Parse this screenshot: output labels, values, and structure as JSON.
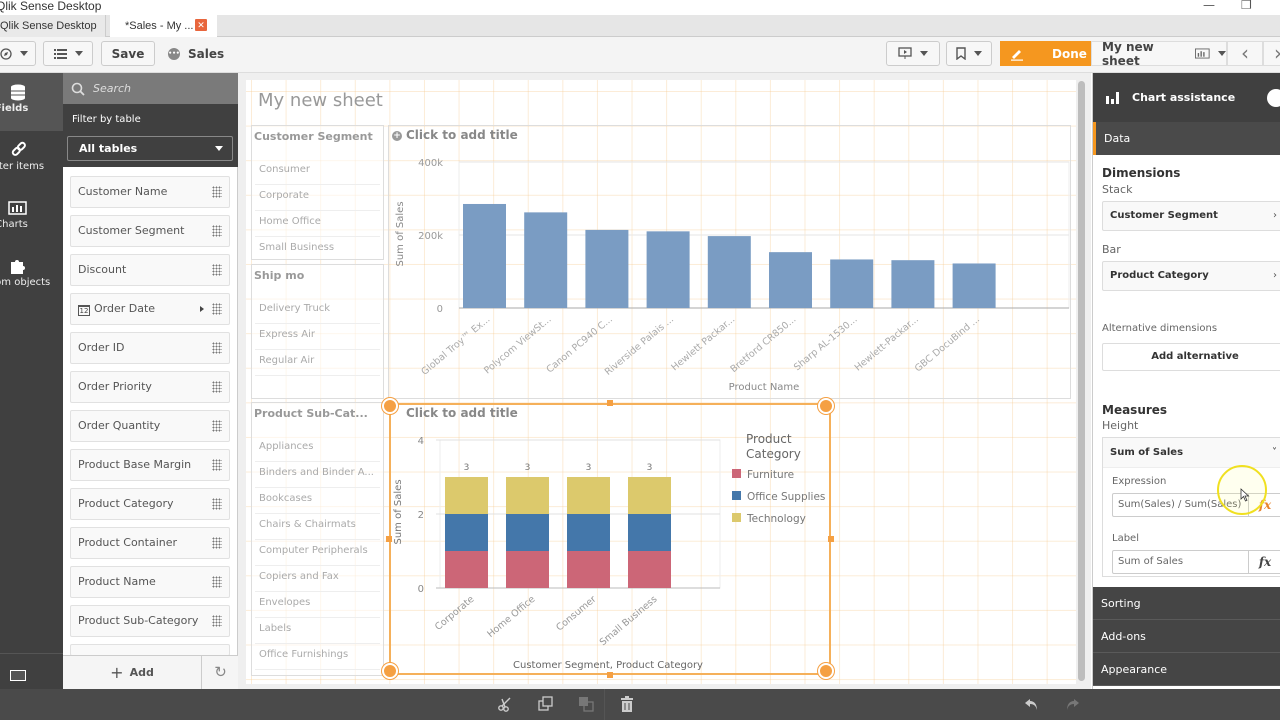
{
  "window": {
    "title": "Qlik Sense Desktop",
    "minimize_glyph": "—",
    "restore_glyph": "❐"
  },
  "tabs": [
    {
      "label": "Qlik Sense Desktop hub",
      "active": false
    },
    {
      "label": "*Sales - My ...",
      "active": true,
      "close_glyph": "✕"
    }
  ],
  "toolbar": {
    "nav_icon": "compass-icon",
    "list_icon": "list-icon",
    "save_label": "Save",
    "app_name": "Sales",
    "present_icon": "presentation-icon",
    "bookmark_icon": "bookmark-icon",
    "done_label": "Done",
    "sheet_name": "My new sheet",
    "prev_glyph": "‹",
    "next_glyph": "›"
  },
  "left_nav": {
    "items": [
      {
        "label": "Fields",
        "icon": "database-icon",
        "active": true
      },
      {
        "label": "Master items",
        "icon": "link-icon",
        "active": false
      },
      {
        "label": "Charts",
        "icon": "bar-chart-icon",
        "active": false
      },
      {
        "label": "Custom objects",
        "icon": "puzzle-icon",
        "active": false
      }
    ],
    "bottom_icon": "variables-icon"
  },
  "fields_panel": {
    "search_placeholder": "Search",
    "filter_label": "Filter by table",
    "table_selected": "All tables",
    "fields": [
      {
        "name": "Customer Name"
      },
      {
        "name": "Customer Segment"
      },
      {
        "name": "Discount"
      },
      {
        "name": "Order Date",
        "calendar": true,
        "calendar_glyph": "12",
        "expandable": true
      },
      {
        "name": "Order ID"
      },
      {
        "name": "Order Priority"
      },
      {
        "name": "Order Quantity"
      },
      {
        "name": "Product Base Margin"
      },
      {
        "name": "Product Category"
      },
      {
        "name": "Product Container"
      },
      {
        "name": "Product Name"
      },
      {
        "name": "Product Sub-Category"
      }
    ],
    "add_label": "Add",
    "add_glyph": "+",
    "refresh_glyph": "↻"
  },
  "sheet": {
    "title": "My new sheet",
    "filter_panes": [
      {
        "title": "Customer Segment",
        "values": [
          "Consumer",
          "Corporate",
          "Home Office",
          "Small Business"
        ]
      },
      {
        "title": "Ship mo",
        "values": [
          "Delivery Truck",
          "Express Air",
          "Regular Air"
        ]
      },
      {
        "title": "Product Sub-Cat...",
        "values": [
          "Appliances",
          "Binders and Binder A...",
          "Bookcases",
          "Chairs & Chairmats",
          "Computer Peripherals",
          "Copiers and Fax",
          "Envelopes",
          "Labels",
          "Office Furnishings"
        ]
      }
    ],
    "add_title_placeholder": "Click to add title",
    "add_title_glyph": "+"
  },
  "chart_data": [
    {
      "type": "bar",
      "title": "Click to add title",
      "xlabel": "Product Name",
      "ylabel": "Sum of Sales",
      "ylim": [
        0,
        400000
      ],
      "yticks": [
        0,
        200000,
        400000
      ],
      "ytick_labels": [
        "0",
        "200k",
        "400k"
      ],
      "categories": [
        "Global Troy™ Ex...",
        "Polycom ViewSt...",
        "Canon PC940 C...",
        "Riverside Palais ...",
        "Hewlett Packar...",
        "Bretford CR850...",
        "Sharp AL-1530...",
        "Hewlett-Packar...",
        "GBC DocuBind ..."
      ],
      "values": [
        285000,
        262000,
        214000,
        210000,
        197000,
        153000,
        133000,
        131000,
        122000
      ],
      "color": "#7a9cc3",
      "grid": true
    },
    {
      "type": "bar",
      "stacked": true,
      "title": "Click to add title",
      "xlabel": "Customer Segment, Product Category",
      "ylabel": "Sum of Sales",
      "ylim": [
        0,
        4
      ],
      "yticks": [
        0,
        2,
        4
      ],
      "ytick_labels": [
        "0",
        "2",
        "4"
      ],
      "categories": [
        "Corporate",
        "Home Office",
        "Consumer",
        "Small Business"
      ],
      "series": [
        {
          "name": "Furniture",
          "color": "#cc6677",
          "values": [
            1,
            1,
            1,
            1
          ]
        },
        {
          "name": "Office Supplies",
          "color": "#4477aa",
          "values": [
            1,
            1,
            1,
            1
          ]
        },
        {
          "name": "Technology",
          "color": "#dcc96c",
          "values": [
            1,
            1,
            1,
            1
          ]
        }
      ],
      "totals": [
        "3",
        "3",
        "3",
        "3"
      ],
      "legend_title": "Product Category",
      "legend_position": "right"
    }
  ],
  "right_panel": {
    "header": "Chart assistance",
    "data_tab": "Data",
    "dimensions_title": "Dimensions",
    "stack_label": "Stack",
    "stack_dimension": "Customer Segment",
    "bar_label": "Bar",
    "bar_dimension": "Product Category",
    "alt_dimensions_label": "Alternative dimensions",
    "add_alternative": "Add alternative",
    "measures_title": "Measures",
    "height_label": "Height",
    "measure_name": "Sum of Sales",
    "expression_label": "Expression",
    "expression_value": "Sum(Sales) / Sum(Sales)",
    "label_label": "Label",
    "label_value": "Sum of Sales",
    "fx_glyph": "fx",
    "chevron_right": "›",
    "chevron_down": "˅",
    "sections": [
      "Sorting",
      "Add-ons",
      "Appearance"
    ]
  },
  "bottom_bar": {
    "icons": [
      "cut-icon",
      "copy-icon",
      "paste-icon",
      "delete-icon",
      "undo-icon",
      "redo-icon"
    ]
  }
}
